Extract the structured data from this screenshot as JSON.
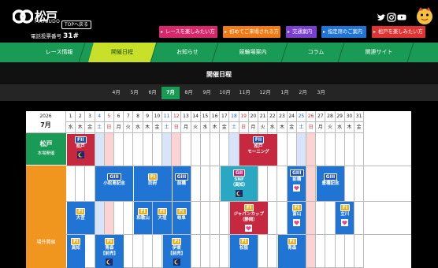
{
  "header": {
    "logo_jp": "松戸",
    "logo_en": "MATSUDO",
    "top_back": "TOPへ戻る",
    "phone_label": "電話投票番号",
    "phone_number": "31#",
    "buttons": [
      {
        "label": "レースを楽しみたい方",
        "color": "#d6286b"
      },
      {
        "label": "初めてご来場される方",
        "color": "#f07a16"
      },
      {
        "label": "交通案内",
        "color": "#7a3fcf"
      },
      {
        "label": "指定席のご案内",
        "color": "#1f74d4"
      },
      {
        "label": "松戸を楽しみたい方",
        "color": "#e03434"
      }
    ],
    "sns": [
      "twitter-icon",
      "instagram-icon",
      "youtube-icon"
    ]
  },
  "nav": {
    "items": [
      "レース情報",
      "開催日程",
      "お知らせ",
      "競輪場案内",
      "コラム",
      "関連サイト"
    ],
    "active": "開催日程"
  },
  "page_title": "開催日程",
  "months": {
    "items": [
      "4月",
      "5月",
      "6月",
      "7月",
      "8月",
      "9月",
      "10月",
      "11月",
      "12月",
      "1月",
      "2月",
      "3月"
    ],
    "active": "7月"
  },
  "calendar": {
    "year": "2026",
    "month": "7月",
    "days": [
      "1",
      "2",
      "3",
      "4",
      "5",
      "6",
      "7",
      "8",
      "9",
      "10",
      "11",
      "12",
      "13",
      "14",
      "15",
      "16",
      "17",
      "18",
      "19",
      "20",
      "21",
      "22",
      "23",
      "24",
      "25",
      "26",
      "27",
      "28",
      "29",
      "30",
      "31"
    ],
    "weekdays": [
      "水",
      "木",
      "金",
      "土",
      "日",
      "月",
      "火",
      "水",
      "木",
      "金",
      "土",
      "日",
      "月",
      "火",
      "水",
      "木",
      "金",
      "土",
      "日",
      "月",
      "火",
      "水",
      "木",
      "金",
      "土",
      "日",
      "月",
      "火",
      "水",
      "木",
      "金"
    ],
    "main_label": "本場開催",
    "main_logo": "松戸",
    "other_label": "場外開催",
    "main_events": [
      {
        "grade": "FII",
        "name": "松戸"
      },
      {
        "grade": "FII",
        "name": "松戸\nモーニング"
      }
    ],
    "row1": [
      {
        "grade": "GIII",
        "name": "小松島記念"
      },
      {
        "grade": "FI",
        "name": "防府"
      },
      {
        "grade": "GIII",
        "name": "前橋"
      },
      {
        "grade": "GII",
        "name": "SNF\n（高知）"
      },
      {
        "grade": "GIII",
        "name": "前橋"
      },
      {
        "grade": "GIII",
        "name": "豊橋記念"
      }
    ],
    "row2": [
      {
        "grade": "FI",
        "name": "大宮"
      },
      {
        "grade": "FI",
        "name": "和歌山"
      },
      {
        "grade": "FI",
        "name": "大垣"
      },
      {
        "grade": "FI",
        "name": "岐阜"
      },
      {
        "grade": "FI",
        "name": "ジャパンカップ\n（静岡）"
      },
      {
        "grade": "FI",
        "name": "富山"
      },
      {
        "grade": "FI",
        "name": "立川"
      }
    ],
    "row3": [
      {
        "grade": "FI",
        "name": "高知"
      },
      {
        "grade": "FI",
        "name": "青森\n【前売】"
      },
      {
        "grade": "FI",
        "name": "伊東\n【前売】"
      },
      {
        "grade": "FI",
        "name": "松阪"
      },
      {
        "grade": "FI",
        "name": "青森"
      }
    ]
  }
}
